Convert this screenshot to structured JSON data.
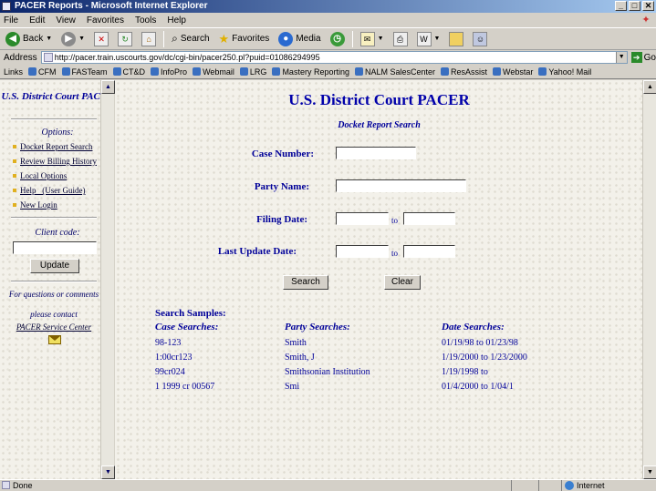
{
  "window": {
    "title": "PACER Reports - Microsoft Internet Explorer",
    "min": "_",
    "max": "□",
    "close": "✕"
  },
  "menu": [
    "File",
    "Edit",
    "View",
    "Favorites",
    "Tools",
    "Help"
  ],
  "toolbar": {
    "back": "Back",
    "search": "Search",
    "favorites": "Favorites",
    "media": "Media"
  },
  "address": {
    "label": "Address",
    "url": "http://pacer.train.uscourts.gov/dc/cgi-bin/pacer250.pl?puid=01086294995",
    "go": "Go"
  },
  "links": {
    "label": "Links",
    "items": [
      "CFM",
      "FASTeam",
      "CT&D",
      "InfoPro",
      "Webmail",
      "LRG",
      "Mastery Reporting",
      "NALM SalesCenter",
      "ResAssist",
      "Webstar",
      "Yahoo! Mail"
    ]
  },
  "sidebar": {
    "title": "U.S. District Court PACER",
    "options_heading": "Options:",
    "options": [
      "Docket Report Search",
      "Review Billing History",
      "Local Options",
      "Help   (User Guide)",
      "New Login"
    ],
    "client_label": "Client code:",
    "update_label": "Update",
    "question": "For questions or comments",
    "contact": "please contact",
    "service": "PACER Service Center"
  },
  "main": {
    "title": "U.S. District Court PACER",
    "subtitle": "Docket Report Search",
    "case_number_label": "Case Number:",
    "party_name_label": "Party Name:",
    "filing_date_label": "Filing Date:",
    "last_update_label": "Last Update Date:",
    "to": "to",
    "search_label": "Search",
    "clear_label": "Clear",
    "samples_title": "Search Samples:",
    "columns": [
      "Case Searches:",
      "Party Searches:",
      "Date Searches:"
    ],
    "rows": [
      [
        "98-123",
        "Smith",
        "01/19/98 to 01/23/98"
      ],
      [
        "1:00cr123",
        "Smith, J",
        "1/19/2000 to 1/23/2000"
      ],
      [
        "99cr024",
        "Smithsonian Institution",
        "1/19/1998 to"
      ],
      [
        "1 1999 cr 00567",
        "Smi",
        "01/4/2000 to 1/04/1"
      ]
    ]
  },
  "status": {
    "left": "Done",
    "right": "Internet"
  }
}
